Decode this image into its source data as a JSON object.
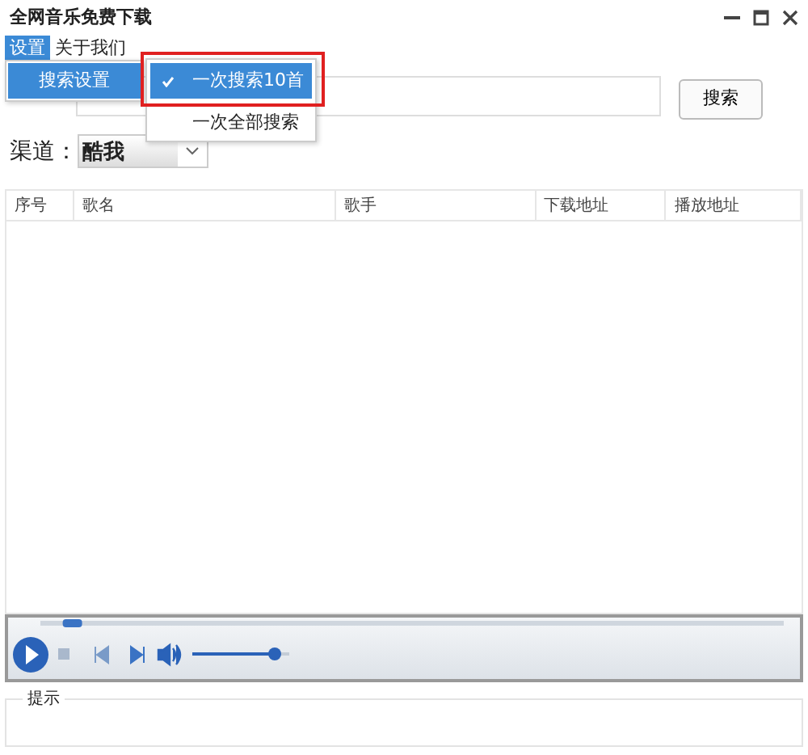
{
  "window": {
    "title": "全网音乐免费下载"
  },
  "menu_bar": [
    {
      "label": "设置",
      "selected": true
    },
    {
      "label": "关于我们",
      "selected": false
    }
  ],
  "open_menu": {
    "items": [
      {
        "label": "搜索设置",
        "selected": true
      }
    ]
  },
  "submenu": {
    "items": [
      {
        "label": "一次搜索10首",
        "checked": true,
        "selected": true
      },
      {
        "label": "一次全部搜索",
        "checked": false,
        "selected": false
      }
    ]
  },
  "search": {
    "button": "搜索"
  },
  "channel": {
    "label": "渠道：",
    "value": "酷我"
  },
  "table": {
    "columns": [
      "序号",
      "歌名",
      "歌手",
      "下载地址",
      "播放地址"
    ]
  },
  "player": {
    "seek": {
      "level": 0.03
    },
    "volume": {
      "level": 0.85
    }
  },
  "hint": {
    "legend": "提示"
  }
}
